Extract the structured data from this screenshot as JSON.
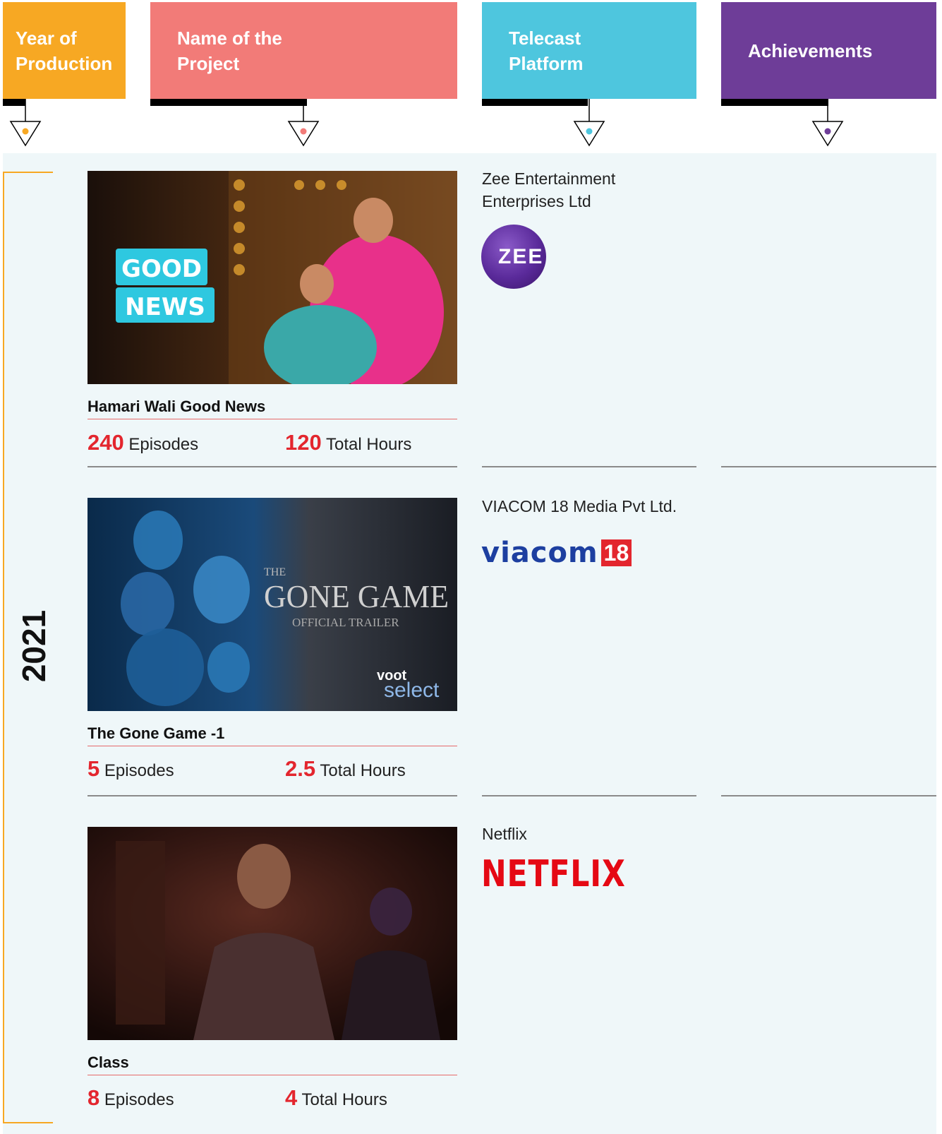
{
  "headers": {
    "year": "Year of Production",
    "year_line1": "Year of",
    "year_line2": "Production",
    "name_line1": "Name of the",
    "name_line2": "Project",
    "telecast_line1": "Telecast",
    "telecast_line2": "Platform",
    "achievements": "Achievements"
  },
  "colors": {
    "year": "#f7a823",
    "name": "#f27b78",
    "telecast": "#4ec6de",
    "achievements": "#6e3d98",
    "accent_red": "#e3262e"
  },
  "year": "2021",
  "projects": [
    {
      "title": "Hamari Wali Good News",
      "episodes": "240",
      "episodes_label": "Episodes",
      "hours": "120",
      "hours_label": "Total Hours",
      "platform_line1": "Zee Entertainment",
      "platform_line2": "Enterprises Ltd",
      "logo_text": "ZEE",
      "thumb_text_1": "GOOD",
      "thumb_text_2": "NEWS"
    },
    {
      "title": "The Gone Game -1",
      "episodes": "5",
      "episodes_label": "Episodes",
      "hours": "2.5",
      "hours_label": "Total Hours",
      "platform_line1": "VIACOM 18 Media Pvt Ltd.",
      "logo_text": "viacom",
      "logo_num": "18",
      "thumb_text_1": "THE",
      "thumb_text_2": "GONE GAME",
      "thumb_text_3": "OFFICIAL TRAILER",
      "thumb_text_4": "voot",
      "thumb_text_5": "select"
    },
    {
      "title": "Class",
      "episodes": "8",
      "episodes_label": "Episodes",
      "hours": "4",
      "hours_label": "Total Hours",
      "platform_line1": "Netflix",
      "logo_text": "NETFLIX"
    }
  ]
}
